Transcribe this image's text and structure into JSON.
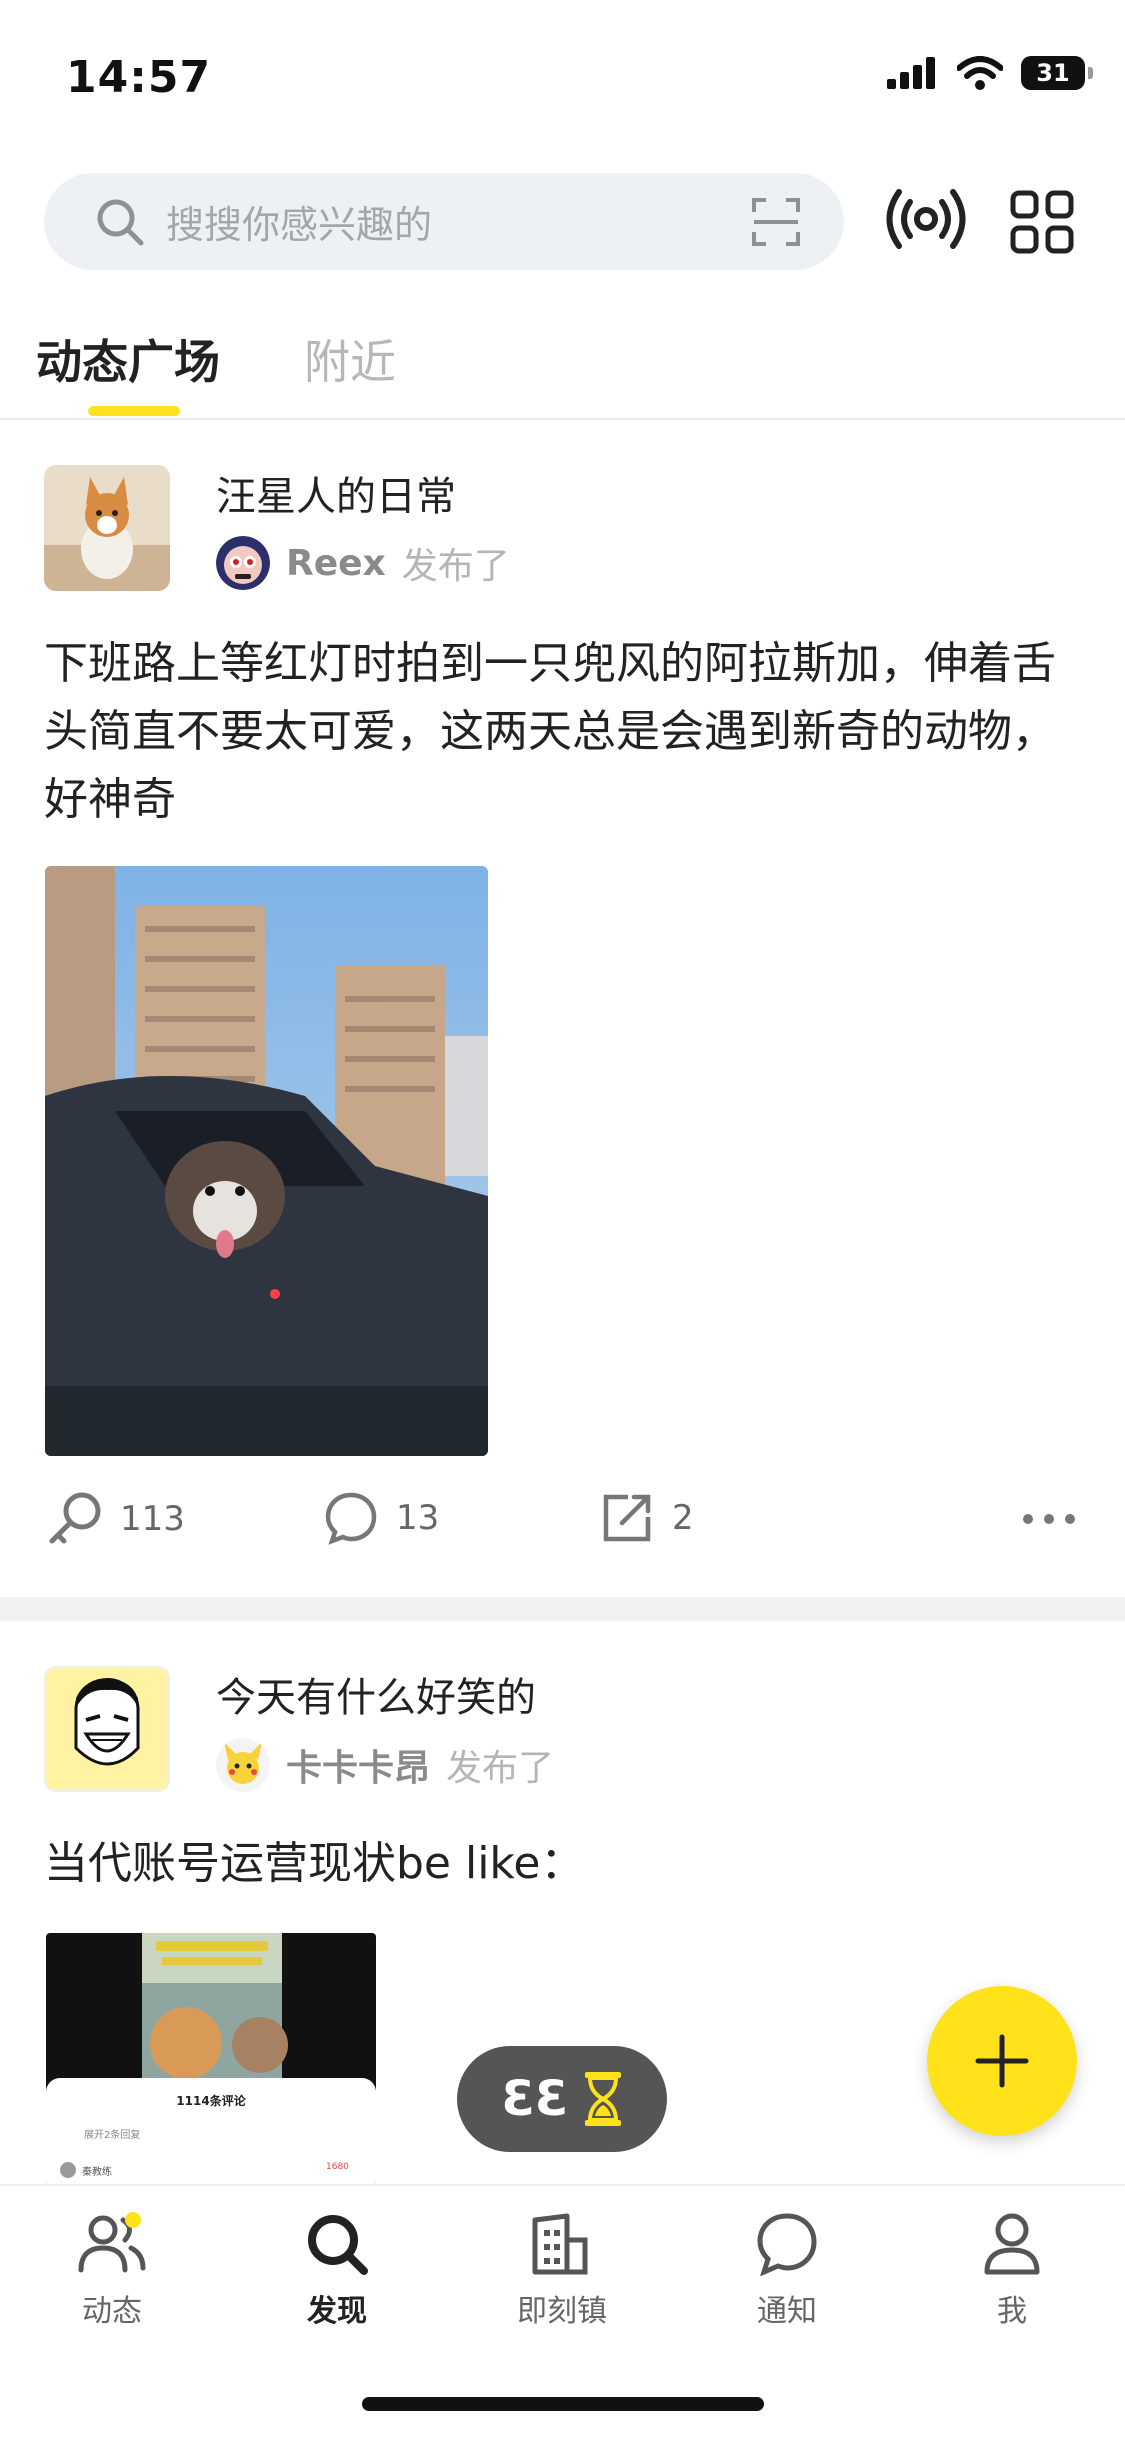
{
  "status_bar": {
    "time": "14:57",
    "battery": "31"
  },
  "search": {
    "placeholder": "搜搜你感兴趣的"
  },
  "tabs": [
    {
      "label": "动态广场",
      "active": true
    },
    {
      "label": "附近",
      "active": false
    }
  ],
  "posts": [
    {
      "group": "汪星人的日常",
      "author": "Reex",
      "published": "发布了",
      "text": "下班路上等红灯时拍到一只兜风的阿拉斯加，伸着舌头简直不要太可爱，这两天总是会遇到新奇的动物，好神奇",
      "likes": "113",
      "comments": "13",
      "shares": "2"
    },
    {
      "group": "今天有什么好笑的",
      "author": "卡卡卡昂",
      "published": "发布了",
      "text": "当代账号运营现状be like：",
      "thumbnail_comment_count": "1114条评论",
      "thumbnail_expand": "展开2条回复",
      "thumbnail_commenter": "秦教练",
      "thumbnail_likes": "1680"
    }
  ],
  "timer": {
    "value": "33"
  },
  "bottom_nav": [
    {
      "label": "动态",
      "icon": "people-icon",
      "badge": true
    },
    {
      "label": "发现",
      "icon": "search-icon",
      "active": true
    },
    {
      "label": "即刻镇",
      "icon": "building-icon"
    },
    {
      "label": "通知",
      "icon": "chat-bubble-icon"
    },
    {
      "label": "我",
      "icon": "person-icon"
    }
  ],
  "colors": {
    "accent": "#FFE21A",
    "text": "#222222",
    "muted": "#8A8A8A"
  }
}
